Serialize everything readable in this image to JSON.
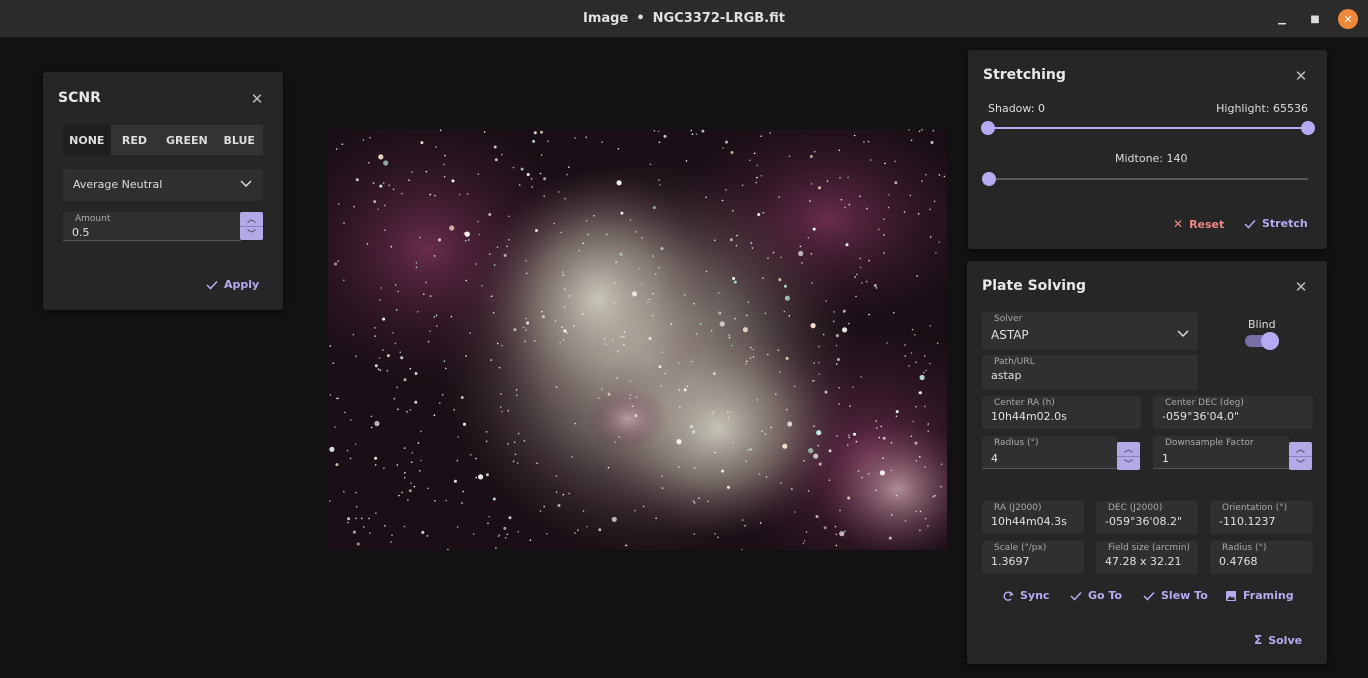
{
  "window": {
    "title_prefix": "Image",
    "separator": "•",
    "filename": "NGC3372-LRGB.fit",
    "minimize_glyph": "▁",
    "maximize_glyph": "■",
    "close_glyph": "✕"
  },
  "colors": {
    "accent": "#b8aaf2",
    "close_button": "#f0883b",
    "reset_red": "#f08787",
    "panel_bg": "#262626",
    "background": "#121212"
  },
  "scnr": {
    "title": "SCNR",
    "close_glyph": "✕",
    "modes": [
      "NONE",
      "RED",
      "GREEN",
      "BLUE"
    ],
    "active_mode": "NONE",
    "method": "Average Neutral",
    "amount_label": "Amount",
    "amount_value": "0.5",
    "apply_label": "Apply"
  },
  "stretching": {
    "title": "Stretching",
    "close_glyph": "✕",
    "shadow_label": "Shadow: 0",
    "highlight_label": "Highlight: 65536",
    "midtone_label": "Midtone: 140",
    "shadow": 0,
    "highlight": 65536,
    "midtone": 140,
    "reset_label": "Reset",
    "stretch_label": "Stretch"
  },
  "plate_solving": {
    "title": "Plate Solving",
    "close_glyph": "✕",
    "solver_label": "Solver",
    "solver_value": "ASTAP",
    "blind_label": "Blind",
    "blind_on": true,
    "path_label": "Path/URL",
    "path_value": "astap",
    "center_ra_label": "Center RA (h)",
    "center_ra_value": "10h44m02.0s",
    "center_dec_label": "Center DEC (deg)",
    "center_dec_value": "-059°36'04.0\"",
    "radius_label": "Radius (°)",
    "radius_value": "4",
    "downsample_label": "Downsample Factor",
    "downsample_value": "1",
    "results": [
      {
        "label": "RA (J2000)",
        "value": "10h44m04.3s"
      },
      {
        "label": "DEC (J2000)",
        "value": "-059°36'08.2\""
      },
      {
        "label": "Orientation (°)",
        "value": "-110.1237"
      },
      {
        "label": "Scale (\"/px)",
        "value": "1.3697"
      },
      {
        "label": "Field size (arcmin)",
        "value": "47.28 x 32.21"
      },
      {
        "label": "Radius (°)",
        "value": "0.4768"
      }
    ],
    "actions": {
      "sync": "Sync",
      "goto": "Go To",
      "slew": "Slew To",
      "framing": "Framing",
      "solve": "Solve"
    }
  }
}
